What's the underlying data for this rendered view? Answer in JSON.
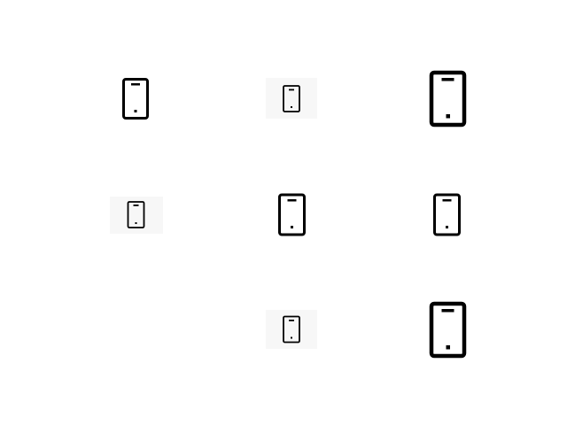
{
  "grid": {
    "rows": 3,
    "columns": 3,
    "icons": [
      {
        "icon": "smartphone-icon",
        "variant": "medium"
      },
      {
        "icon": "smartphone-icon",
        "variant": "small-on-light-gray"
      },
      {
        "icon": "smartphone-icon",
        "variant": "large-bold"
      },
      {
        "icon": "smartphone-icon",
        "variant": "small-on-light-gray"
      },
      {
        "icon": "smartphone-icon",
        "variant": "medium"
      },
      {
        "icon": "smartphone-icon",
        "variant": "medium"
      },
      {
        "icon": "smartphone-icon",
        "variant": "small-on-light-gray"
      },
      {
        "icon": "smartphone-icon",
        "variant": "large-bold"
      }
    ],
    "empty_slot": "row-3-col-1"
  },
  "colors": {
    "background": "#ffffff",
    "icon_stroke": "#000000",
    "halo": "#f7f7f7"
  }
}
